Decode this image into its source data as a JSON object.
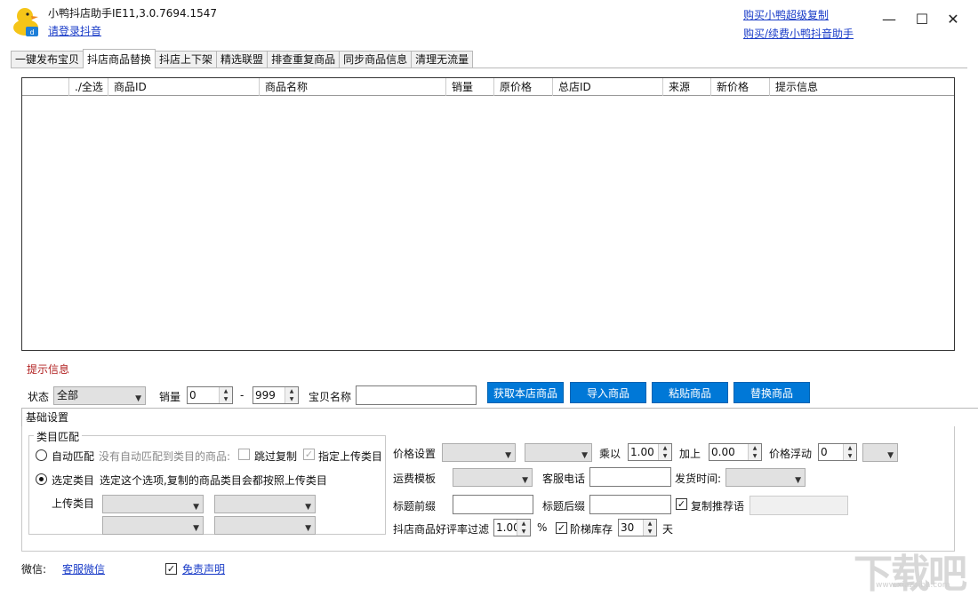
{
  "app": {
    "title": "小鸭抖店助手IE11,3.0.7694.1547",
    "login_link": "请登录抖音",
    "buy_links": [
      "购买小鸭超级复制",
      "购买/续费小鸭抖音助手"
    ],
    "window_controls": {
      "minimize": "—",
      "maximize": "☐",
      "close": "✕"
    }
  },
  "tabs": [
    {
      "label": "一键发布宝贝",
      "active": false
    },
    {
      "label": "抖店商品替换",
      "active": true
    },
    {
      "label": "抖店上下架",
      "active": false
    },
    {
      "label": "精选联盟",
      "active": false
    },
    {
      "label": "排查重复商品",
      "active": false
    },
    {
      "label": "同步商品信息",
      "active": false
    },
    {
      "label": "清理无流量",
      "active": false
    }
  ],
  "grid": {
    "columns": [
      "",
      "./全选",
      "商品ID",
      "商品名称",
      "销量",
      "原价格",
      "总店ID",
      "来源",
      "新价格",
      "提示信息"
    ],
    "rows": []
  },
  "tip_label": "提示信息",
  "filters": {
    "status_label": "状态",
    "status_value": "全部",
    "sales_label": "销量",
    "sales_min": "0",
    "sales_dash": "-",
    "sales_max": "999",
    "name_label": "宝贝名称",
    "name_value": ""
  },
  "actions": [
    "获取本店商品",
    "导入商品",
    "粘贴商品",
    "替换商品"
  ],
  "settings_tab": "基础设置",
  "category": {
    "group_title": "类目匹配",
    "auto_label": "自动匹配",
    "auto_hint": "没有自动匹配到类目的商品:",
    "skip_copy": "跳过复制",
    "specify_upload": "指定上传类目",
    "select_label": "选定类目",
    "select_hint": "选定这个选项,复制的商品类目会都按照上传类目",
    "upload_label": "上传类目"
  },
  "price": {
    "price_label": "价格设置",
    "multiply_label": "乘以",
    "multiply_value": "1.00",
    "add_label": "加上",
    "add_value": "0.00",
    "float_label": "价格浮动",
    "float_value": "0",
    "freight_label": "运费模板",
    "phone_label": "客服电话",
    "ship_label": "发货时间:",
    "prefix_label": "标题前缀",
    "suffix_label": "标题后缀",
    "copy_recommend": "复制推荐语",
    "rate_label": "抖店商品好评率过滤",
    "rate_value": "1.00",
    "rate_unit": "%",
    "ladder_label": "阶梯库存",
    "ladder_value": "30",
    "ladder_unit": "天"
  },
  "footer": {
    "wechat_label": "微信:",
    "wechat_link": "客服微信",
    "disclaimer": "免责声明"
  },
  "watermark": {
    "main": "下载吧",
    "sub": "www.xiazaiba.com"
  },
  "colors": {
    "accent": "#0078d7",
    "link": "#1a3cc8",
    "tip": "#b22222"
  }
}
